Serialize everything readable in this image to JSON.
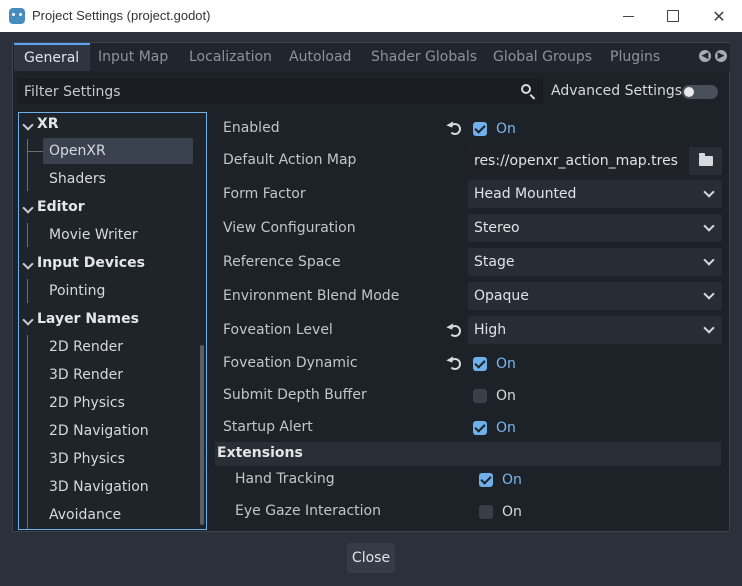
{
  "window": {
    "title": "Project Settings (project.godot)"
  },
  "tabs": [
    "General",
    "Input Map",
    "Localization",
    "Autoload",
    "Shader Globals",
    "Global Groups",
    "Plugins"
  ],
  "filter": {
    "placeholder": "Filter Settings"
  },
  "advanced": {
    "label": "Advanced Settings",
    "enabled": false
  },
  "tree": [
    {
      "label": "XR",
      "type": "section"
    },
    {
      "label": "OpenXR",
      "type": "child",
      "selected": true
    },
    {
      "label": "Shaders",
      "type": "child"
    },
    {
      "label": "Editor",
      "type": "section"
    },
    {
      "label": "Movie Writer",
      "type": "child"
    },
    {
      "label": "Input Devices",
      "type": "section"
    },
    {
      "label": "Pointing",
      "type": "child"
    },
    {
      "label": "Layer Names",
      "type": "section"
    },
    {
      "label": "2D Render",
      "type": "child"
    },
    {
      "label": "3D Render",
      "type": "child"
    },
    {
      "label": "2D Physics",
      "type": "child"
    },
    {
      "label": "2D Navigation",
      "type": "child"
    },
    {
      "label": "3D Physics",
      "type": "child"
    },
    {
      "label": "3D Navigation",
      "type": "child"
    },
    {
      "label": "Avoidance",
      "type": "child"
    }
  ],
  "settings": {
    "enabled": {
      "label": "Enabled",
      "value": "On",
      "checked": true
    },
    "action_map": {
      "label": "Default Action Map",
      "value": "res://openxr_action_map.tres"
    },
    "form_factor": {
      "label": "Form Factor",
      "value": "Head Mounted"
    },
    "view_config": {
      "label": "View Configuration",
      "value": "Stereo"
    },
    "ref_space": {
      "label": "Reference Space",
      "value": "Stage"
    },
    "blend_mode": {
      "label": "Environment Blend Mode",
      "value": "Opaque"
    },
    "fov_level": {
      "label": "Foveation Level",
      "value": "High"
    },
    "fov_dynamic": {
      "label": "Foveation Dynamic",
      "value": "On",
      "checked": true
    },
    "depth_buffer": {
      "label": "Submit Depth Buffer",
      "value": "On",
      "checked": false
    },
    "startup_alert": {
      "label": "Startup Alert",
      "value": "On",
      "checked": true
    },
    "extensions": {
      "label": "Extensions"
    },
    "hand_tracking": {
      "label": "Hand Tracking",
      "value": "On",
      "checked": true
    },
    "eye_gaze": {
      "label": "Eye Gaze Interaction",
      "value": "On",
      "checked": false
    }
  },
  "footer": {
    "close_label": "Close"
  }
}
